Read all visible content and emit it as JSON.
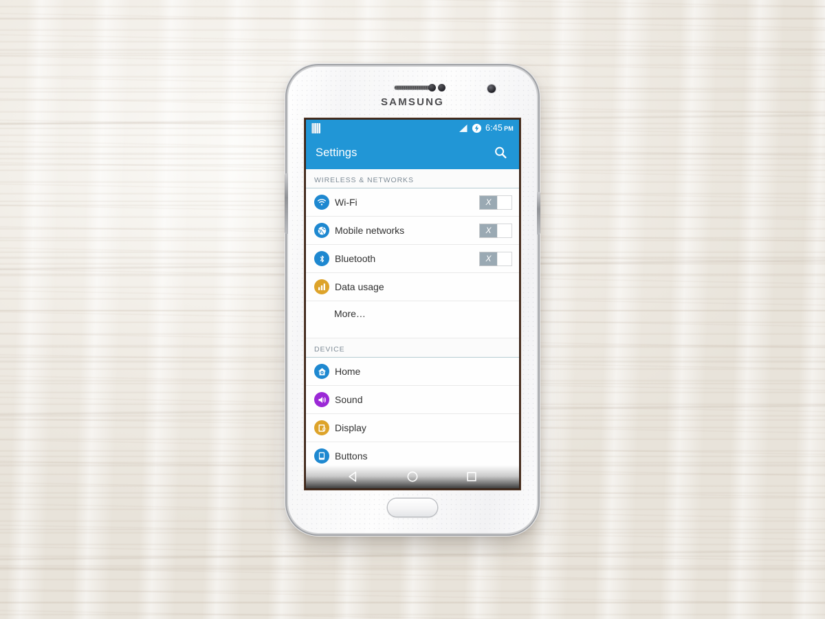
{
  "device": {
    "brand": "SAMSUNG",
    "icons": {
      "earpiece": "earpiece-speaker-icon",
      "sensor_1": "proximity-sensor-icon",
      "sensor_2": "light-sensor-icon",
      "camera": "front-camera-icon",
      "home": "physical-home-button",
      "power": "power-button",
      "volume": "volume-button"
    }
  },
  "status_bar": {
    "notification_icon": "notification-icon",
    "signal_icon": "signal-strength-icon",
    "battery_icon": "battery-charging-icon",
    "time": "6:45",
    "ampm": "PM",
    "background": "#2196d6"
  },
  "app_bar": {
    "title": "Settings",
    "search_icon": "search-icon",
    "background": "#2196d6"
  },
  "sections": [
    {
      "header": "WIRELESS & NETWORKS",
      "rows": [
        {
          "label": "Wi-Fi",
          "icon": "wifi-icon",
          "icon_color": "#1e88d0",
          "toggle": true,
          "toggle_state": "off",
          "toggle_mark": "X"
        },
        {
          "label": "Mobile networks",
          "icon": "globe-icon",
          "icon_color": "#1e88d0",
          "toggle": true,
          "toggle_state": "off",
          "toggle_mark": "X"
        },
        {
          "label": "Bluetooth",
          "icon": "bluetooth-icon",
          "icon_color": "#1e88d0",
          "toggle": true,
          "toggle_state": "off",
          "toggle_mark": "X"
        },
        {
          "label": "Data usage",
          "icon": "bar-chart-icon",
          "icon_color": "#dda32a",
          "toggle": false
        },
        {
          "label": "More…",
          "icon": null,
          "toggle": false
        }
      ]
    },
    {
      "header": "DEVICE",
      "rows": [
        {
          "label": "Home",
          "icon": "home-gear-icon",
          "icon_color": "#1e88d0",
          "toggle": false
        },
        {
          "label": "Sound",
          "icon": "speaker-icon",
          "icon_color": "#9b28d6",
          "toggle": false
        },
        {
          "label": "Display",
          "icon": "brightness-icon",
          "icon_color": "#dda32a",
          "toggle": false
        },
        {
          "label": "Buttons",
          "icon": "tablet-icon",
          "icon_color": "#1e88d0",
          "toggle": false
        }
      ]
    }
  ],
  "nav_bar": {
    "back": "back-triangle-icon",
    "home": "home-circle-icon",
    "recents": "recents-square-icon"
  }
}
